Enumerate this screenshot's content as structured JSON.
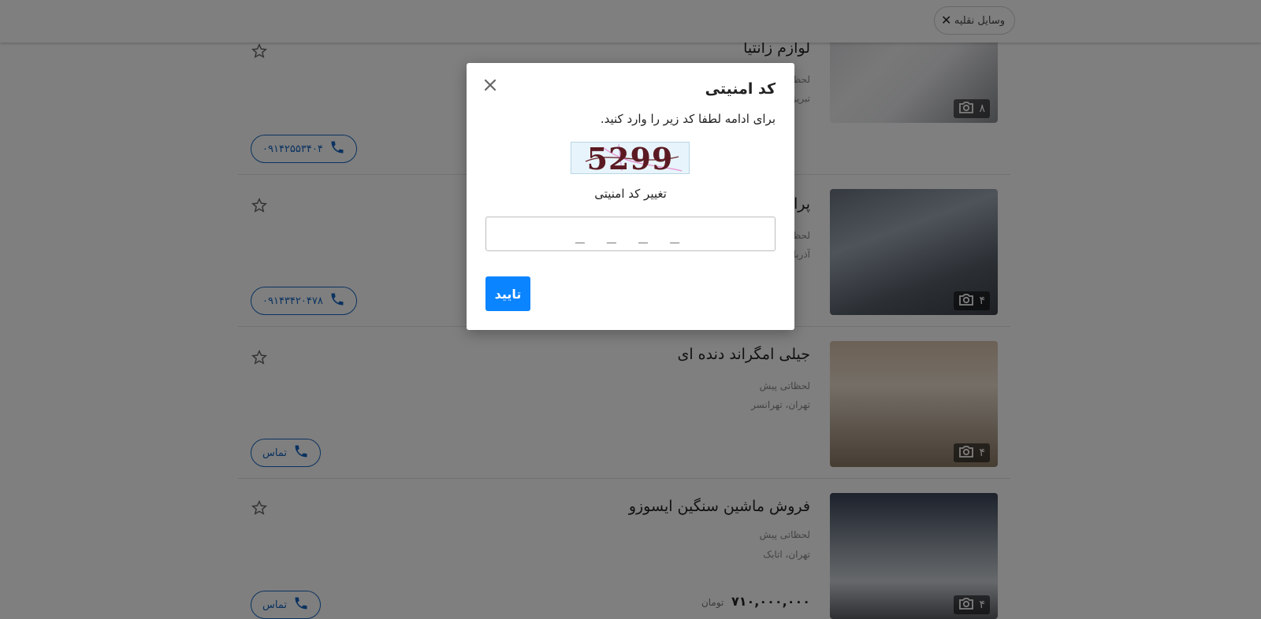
{
  "header": {
    "filter_chip": "وسایل نقلیه"
  },
  "listings": [
    {
      "title": "لوازم زانتیا",
      "time": "لحظاتی پیش",
      "location": "تبریز",
      "photo_count": "۸",
      "phone": "۰۹۱۴۲۵۵۳۴۰۴",
      "price": "",
      "currency": ""
    },
    {
      "title": "پراید",
      "time": "لحظاتی پیش",
      "location": "آذربایجان",
      "photo_count": "۴",
      "phone": "۰۹۱۴۳۴۲۰۴۷۸",
      "price": "",
      "currency": ""
    },
    {
      "title": "جیلی امگراند دنده ای",
      "time": "لحظاتی پیش",
      "location": "تهران، تهرانسر",
      "photo_count": "۴",
      "phone": "تماس",
      "price": "",
      "currency": ""
    },
    {
      "title": "فروش ماشین سنگین ایسوزو",
      "time": "لحظاتی پیش",
      "location": "تهران، اتابک",
      "photo_count": "۴",
      "phone": "تماس",
      "price": "۷۱۰,۰۰۰,۰۰۰",
      "currency": "تومان"
    }
  ],
  "modal": {
    "title": "کد امنیتی",
    "description": "برای ادامه لطفا کد زیر را وارد کنید.",
    "captcha_text": "5299",
    "refresh_label": "تغییر کد امنیتی",
    "input_placeholder": "_ _ _ _",
    "input_value": "",
    "submit_label": "تایید"
  },
  "colors": {
    "accent": "#0a84ff",
    "call_border": "#1565c0",
    "overlay": "rgba(0,0,0,0.5)"
  }
}
